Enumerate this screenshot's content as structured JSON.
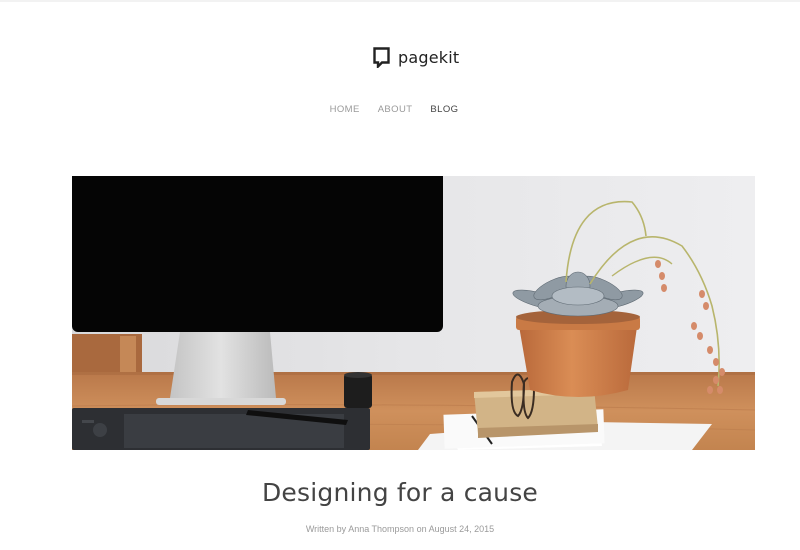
{
  "site": {
    "logo_text": "pagekit",
    "logo_icon": "pagekit-logo-icon"
  },
  "nav": {
    "items": [
      {
        "label": "HOME",
        "active": false
      },
      {
        "label": "ABOUT",
        "active": false
      },
      {
        "label": "BLOG",
        "active": true
      }
    ]
  },
  "hero": {
    "image": "desk-monitor-succulent-photo",
    "colors": {
      "wall": "#e4e4e6",
      "desk": "#c98a55",
      "pot": "#d0834a",
      "monitor": "#050505"
    }
  },
  "post": {
    "title": "Designing for a cause",
    "meta": {
      "prefix": "Written by",
      "author": "Anna Thompson",
      "on": "on",
      "date": "August 24, 2015"
    }
  }
}
